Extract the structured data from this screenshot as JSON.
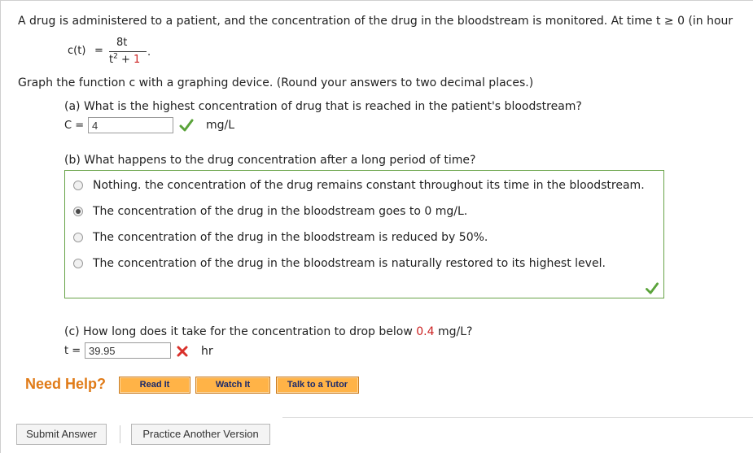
{
  "problem": {
    "intro": "A drug is administered to a patient, and the concentration of the drug in the bloodstream is monitored. At time t ≥ 0 (in hour",
    "func_lhs": "c(t)",
    "equals": "=",
    "numerator": "8t",
    "denominator_base": "t",
    "denominator_exp": "2",
    "denominator_plus": " + ",
    "denominator_const": "1",
    "period": ".",
    "graph_instruction": "Graph the function c with a graphing device. (Round your answers to two decimal places.)"
  },
  "part_a": {
    "question": "(a) What is the highest concentration of drug that is reached in the patient's bloodstream?",
    "var_label": "C =",
    "value": "4",
    "unit": "mg/L",
    "status": "correct"
  },
  "part_b": {
    "question": "(b) What happens to the drug concentration after a long period of time?",
    "options": [
      {
        "label": "Nothing. the concentration of the drug remains constant throughout its time in the bloodstream.",
        "selected": false
      },
      {
        "label": "The concentration of the drug in the bloodstream goes to 0 mg/L.",
        "selected": true
      },
      {
        "label": "The concentration of the drug in the bloodstream is reduced by 50%.",
        "selected": false
      },
      {
        "label": "The concentration of the drug in the bloodstream is naturally restored to its highest level.",
        "selected": false
      }
    ],
    "status": "correct"
  },
  "part_c": {
    "question_prefix": "(c) How long does it take for the concentration to drop below ",
    "highlight_value": "0.4",
    "question_suffix": " mg/L?",
    "var_label": "t =",
    "value": "39.95",
    "unit": "hr",
    "status": "incorrect"
  },
  "help": {
    "title": "Need Help?",
    "buttons": [
      "Read It",
      "Watch It",
      "Talk to a Tutor"
    ]
  },
  "footer": {
    "submit_label": "Submit Answer",
    "practice_label": "Practice Another Version"
  },
  "colors": {
    "correct": "#5aa33a",
    "incorrect": "#d9312b",
    "highlight": "#cc2222",
    "help_title": "#e07b18",
    "help_button": "#ffb347",
    "choice_border": "#68a348"
  },
  "icons": {
    "correct": "checkmark-icon",
    "incorrect": "x-mark-icon"
  }
}
